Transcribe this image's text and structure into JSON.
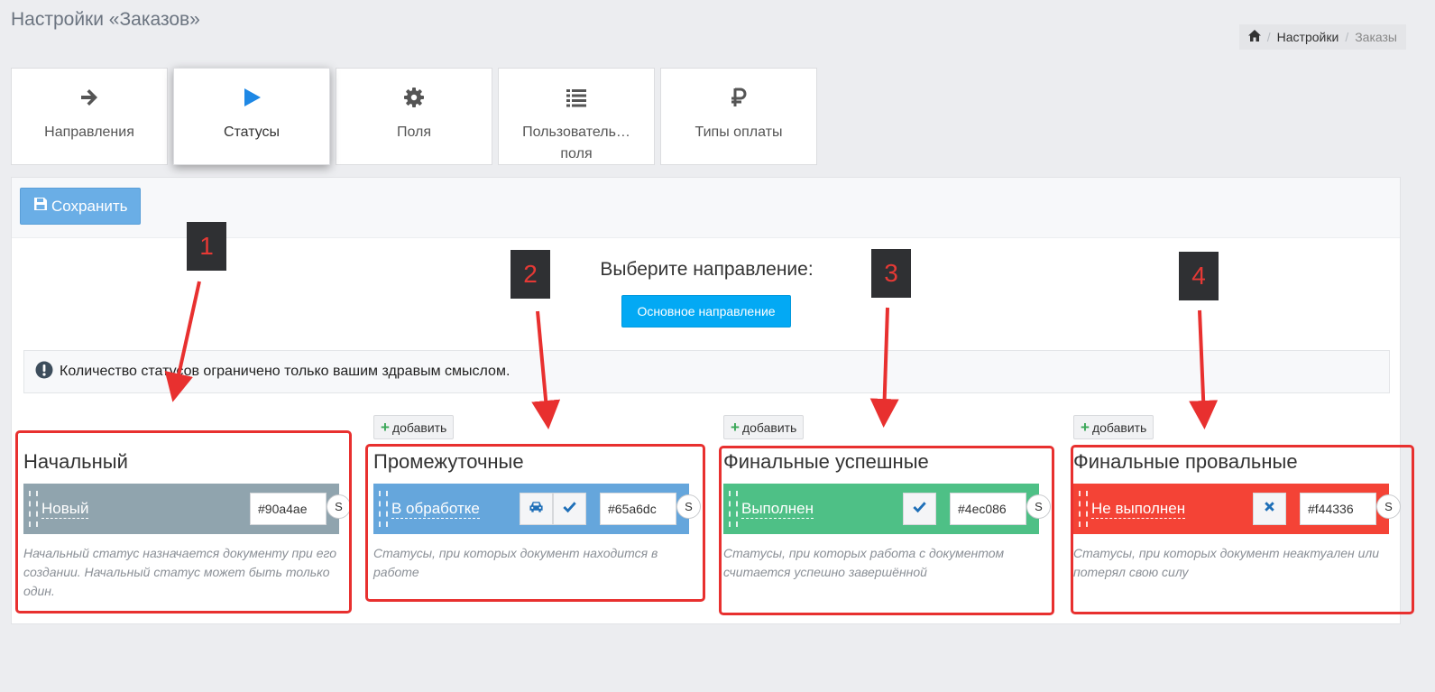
{
  "page": {
    "title": "Настройки «Заказов»"
  },
  "breadcrumb": {
    "icon": "home-icon",
    "items": [
      "Настройки",
      "Заказы"
    ],
    "separator": "/"
  },
  "tabs": [
    {
      "label": "Направления",
      "icon": "arrow-right-icon",
      "active": false
    },
    {
      "label": "Статусы",
      "icon": "play-icon",
      "active": true
    },
    {
      "label": "Поля",
      "icon": "gear-icon",
      "active": false
    },
    {
      "label": "Пользователь… поля",
      "icon": "list-icon",
      "active": false
    },
    {
      "label": "Типы оплаты",
      "icon": "ruble-icon",
      "active": false
    }
  ],
  "toolbar": {
    "save_label": "Сохранить",
    "save_icon": "floppy-disk-icon"
  },
  "direction": {
    "title": "Выберите направление:",
    "button_label": "Основное направление",
    "button_color": "#03a9f4"
  },
  "alert": {
    "icon": "exclamation-circle-icon",
    "text": "Количество статусов ограничено только вашим здравым смыслом."
  },
  "add_label": "добавить",
  "columns": [
    {
      "title": "Начальный",
      "status": "Новый",
      "color": "#90a4ae",
      "buttons": [],
      "s_label": "S",
      "description": "Начальный статус назначается документу при его создании. Начальный статус может быть только один."
    },
    {
      "title": "Промежуточные",
      "status": "В обработке",
      "color": "#65a6dc",
      "buttons": [
        "car-icon",
        "check-icon"
      ],
      "s_label": "S",
      "description": "Статусы, при которых документ находится в работе"
    },
    {
      "title": "Финальные успешные",
      "status": "Выполнен",
      "color": "#4ec086",
      "buttons": [
        "check-icon"
      ],
      "s_label": "S",
      "description": "Статусы, при которых работа с документом считается успешно завершённой"
    },
    {
      "title": "Финальные провальные",
      "status": "Не выполнен",
      "color": "#f44336",
      "buttons": [
        "times-icon"
      ],
      "s_label": "S",
      "description": "Статусы, при которых документ неактуален или потерял свою силу"
    }
  ],
  "annotations": [
    "1",
    "2",
    "3",
    "4"
  ],
  "colors": {
    "annotation": "#e8302f",
    "badge_bg": "#2f3033",
    "accent": "#03a9f4"
  }
}
